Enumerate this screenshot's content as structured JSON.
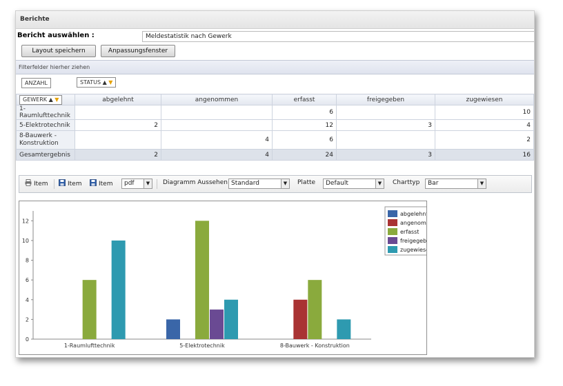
{
  "title": "Berichte",
  "report": {
    "label": "Bericht auswählen :",
    "value": "Meldestatistik nach Gewerk"
  },
  "buttons": {
    "save_layout": "Layout speichern",
    "adjust_window": "Anpassungsfenster"
  },
  "filter_hint": "Filterfelder hierher ziehen",
  "fields": {
    "data": "ANZAHL",
    "column": "STATUS",
    "row": "GEWERK"
  },
  "pivot": {
    "columns": [
      "abgelehnt",
      "angenommen",
      "erfasst",
      "freigegeben",
      "zugewiesen"
    ],
    "rows": [
      {
        "label": "1-Raumlufttechnik",
        "values": [
          "",
          "",
          "6",
          "",
          "10"
        ]
      },
      {
        "label": "5-Elektrotechnik",
        "values": [
          "2",
          "",
          "12",
          "3",
          "4"
        ]
      },
      {
        "label": "8-Bauwerk - Konstruktion",
        "values": [
          "",
          "4",
          "6",
          "",
          "2"
        ]
      }
    ],
    "total": {
      "label": "Gesamtergebnis",
      "values": [
        "2",
        "4",
        "24",
        "3",
        "16"
      ]
    }
  },
  "toolbar": {
    "item1": "Item",
    "item2": "Item",
    "item3": "Item",
    "format": "pdf",
    "appearance_label": "Diagramm Aussehen",
    "appearance_value": "Standard",
    "palette_label": "Platte",
    "palette_value": "Default",
    "charttype_label": "Charttyp",
    "charttype_value": "Bar",
    "icons": [
      "printer-icon",
      "save-icon",
      "save-icon"
    ]
  },
  "chart_data": {
    "type": "bar",
    "categories": [
      "1-Raumlufttechnik",
      "5-Elektrotechnik",
      "8-Bauwerk - Konstruktion"
    ],
    "series": [
      {
        "name": "abgelehnt",
        "values": [
          0,
          2,
          0
        ],
        "color": "#3a66a8"
      },
      {
        "name": "angenommen",
        "values": [
          0,
          0,
          4
        ],
        "color": "#a93333"
      },
      {
        "name": "erfasst",
        "values": [
          6,
          12,
          6
        ],
        "color": "#8aaa3d"
      },
      {
        "name": "freigegeben",
        "values": [
          0,
          3,
          0
        ],
        "color": "#6a4a93"
      },
      {
        "name": "zugewiesen",
        "values": [
          10,
          4,
          2
        ],
        "color": "#2e9ab0"
      }
    ],
    "y_ticks": [
      0,
      2,
      4,
      6,
      8,
      10,
      12
    ],
    "ylim": [
      0,
      13
    ],
    "legend": "top-right",
    "grid": false
  }
}
